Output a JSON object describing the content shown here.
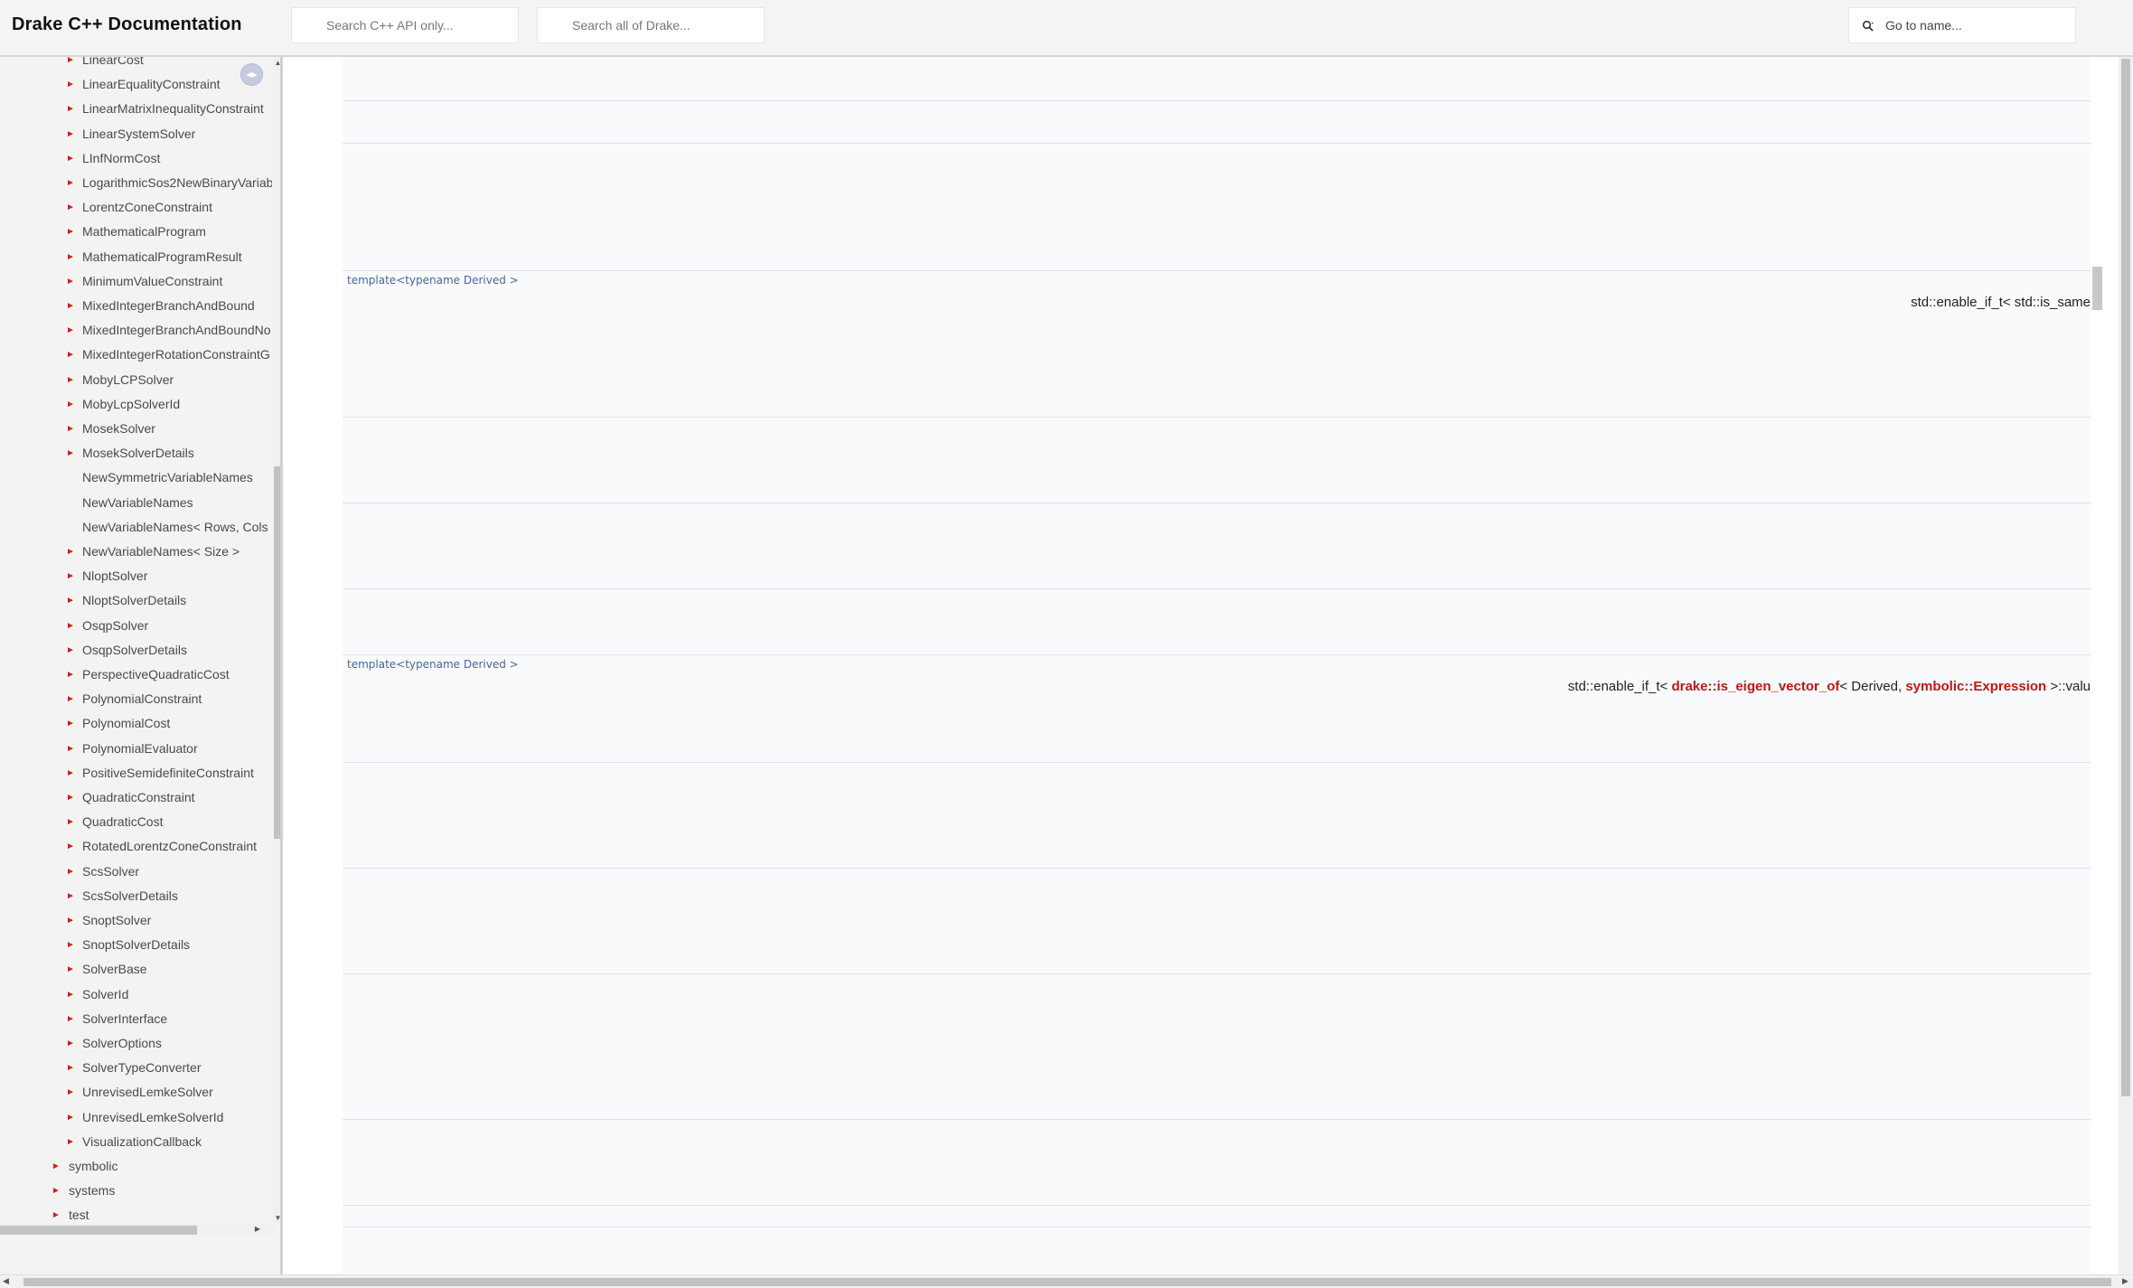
{
  "header": {
    "title": "Drake C++ Documentation",
    "search_api_placeholder": "Search C++ API only...",
    "search_drake_placeholder": "Search all of Drake...",
    "goto_placeholder": "Go to name..."
  },
  "sidebar": {
    "items": [
      {
        "label": "LinearCost",
        "arrow": true
      },
      {
        "label": "LinearEqualityConstraint",
        "arrow": true
      },
      {
        "label": "LinearMatrixInequalityConstraint",
        "arrow": true
      },
      {
        "label": "LinearSystemSolver",
        "arrow": true
      },
      {
        "label": "LInfNormCost",
        "arrow": true
      },
      {
        "label": "LogarithmicSos2NewBinaryVariab",
        "arrow": true
      },
      {
        "label": "LorentzConeConstraint",
        "arrow": true
      },
      {
        "label": "MathematicalProgram",
        "arrow": true
      },
      {
        "label": "MathematicalProgramResult",
        "arrow": true
      },
      {
        "label": "MinimumValueConstraint",
        "arrow": true
      },
      {
        "label": "MixedIntegerBranchAndBound",
        "arrow": true
      },
      {
        "label": "MixedIntegerBranchAndBoundNo",
        "arrow": true
      },
      {
        "label": "MixedIntegerRotationConstraintG",
        "arrow": true
      },
      {
        "label": "MobyLCPSolver",
        "arrow": true
      },
      {
        "label": "MobyLcpSolverId",
        "arrow": true
      },
      {
        "label": "MosekSolver",
        "arrow": true
      },
      {
        "label": "MosekSolverDetails",
        "arrow": true
      },
      {
        "label": "NewSymmetricVariableNames",
        "arrow": false
      },
      {
        "label": "NewVariableNames",
        "arrow": false
      },
      {
        "label": "NewVariableNames< Rows, Cols",
        "arrow": false
      },
      {
        "label": "NewVariableNames< Size >",
        "arrow": true
      },
      {
        "label": "NloptSolver",
        "arrow": true
      },
      {
        "label": "NloptSolverDetails",
        "arrow": true
      },
      {
        "label": "OsqpSolver",
        "arrow": true
      },
      {
        "label": "OsqpSolverDetails",
        "arrow": true
      },
      {
        "label": "PerspectiveQuadraticCost",
        "arrow": true
      },
      {
        "label": "PolynomialConstraint",
        "arrow": true
      },
      {
        "label": "PolynomialCost",
        "arrow": true
      },
      {
        "label": "PolynomialEvaluator",
        "arrow": true
      },
      {
        "label": "PositiveSemidefiniteConstraint",
        "arrow": true
      },
      {
        "label": "QuadraticConstraint",
        "arrow": true
      },
      {
        "label": "QuadraticCost",
        "arrow": true
      },
      {
        "label": "RotatedLorentzConeConstraint",
        "arrow": true
      },
      {
        "label": "ScsSolver",
        "arrow": true
      },
      {
        "label": "ScsSolverDetails",
        "arrow": true
      },
      {
        "label": "SnoptSolver",
        "arrow": true
      },
      {
        "label": "SnoptSolverDetails",
        "arrow": true
      },
      {
        "label": "SolverBase",
        "arrow": true
      },
      {
        "label": "SolverId",
        "arrow": true
      },
      {
        "label": "SolverInterface",
        "arrow": true
      },
      {
        "label": "SolverOptions",
        "arrow": true
      },
      {
        "label": "SolverTypeConverter",
        "arrow": true
      },
      {
        "label": "UnrevisedLemkeSolver",
        "arrow": true
      },
      {
        "label": "UnrevisedLemkeSolverId",
        "arrow": true
      },
      {
        "label": "VisualizationCallback",
        "arrow": true
      },
      {
        "label": "symbolic",
        "arrow": true,
        "level": 1
      },
      {
        "label": "systems",
        "arrow": true,
        "level": 1
      },
      {
        "label": "test",
        "arrow": true,
        "level": 1
      }
    ]
  },
  "content": {
    "template_1": "template<typename Derived >",
    "signature_1": "std::enable_if_t< std::is_same",
    "template_2": "template<typename Derived >",
    "signature_2": {
      "prefix": "std::enable_if_t< ",
      "link_1": "drake::is_eigen_vector_of",
      "middle": "< Derived, ",
      "link_2": "symbolic::Expression",
      "suffix": " >::valu"
    }
  },
  "colors": {
    "arrow": "#d12020",
    "link": "#c01616",
    "template": "#4665a2",
    "table_bg": "#f9fafc"
  }
}
